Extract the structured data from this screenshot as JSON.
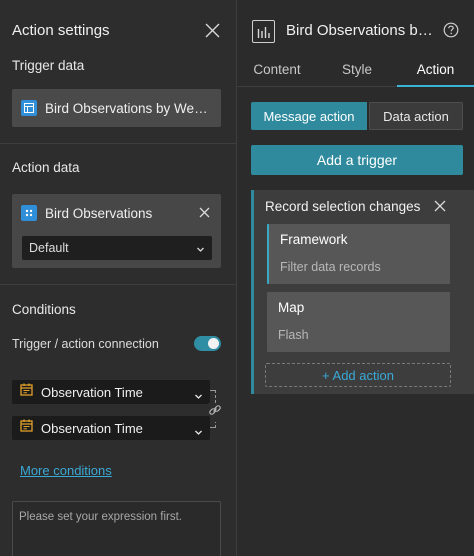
{
  "left_panel": {
    "title": "Action settings",
    "trigger_data_label": "Trigger data",
    "trigger_data_source": "Bird Observations by Weather",
    "action_data_label": "Action data",
    "action_data_source": "Bird Observations",
    "action_data_view": "Default",
    "conditions_label": "Conditions",
    "trigger_action_connection_label": "Trigger / action connection",
    "trigger_action_connection_on": true,
    "condition_fields": [
      "Observation Time",
      "Observation Time"
    ],
    "more_conditions_link": "More conditions",
    "expression_placeholder": "Please set your expression first."
  },
  "right_panel": {
    "widget_title": "Bird Observations by Weather",
    "tabs": [
      "Content",
      "Style",
      "Action"
    ],
    "active_tab": "Action",
    "segments": [
      "Message action",
      "Data action"
    ],
    "active_segment": "Message action",
    "add_trigger_label": "Add a trigger",
    "trigger_card": {
      "title": "Record selection changes",
      "actions": [
        {
          "name": "Framework",
          "description": "Filter data records"
        },
        {
          "name": "Map",
          "description": "Flash"
        }
      ],
      "add_action_label": "+ Add action"
    }
  },
  "colors": {
    "accent": "#2f8a9e",
    "link": "#3aa9d6",
    "datasource_icon": "#2f8fd8",
    "field_icon": "#e0a02a"
  },
  "icons": [
    "close-icon",
    "datasource-icon",
    "chevron-down-icon",
    "calendar-icon",
    "link-icon",
    "widget-chart-icon",
    "help-icon"
  ]
}
